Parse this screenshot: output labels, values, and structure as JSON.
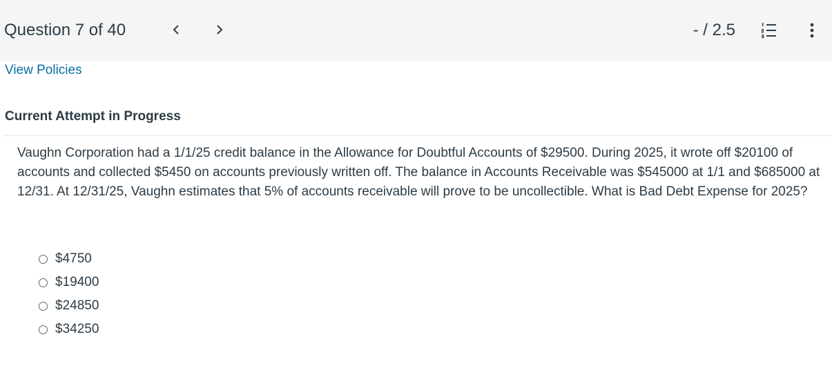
{
  "header": {
    "question_label": "Question 7 of 40",
    "score": "- / 2.5",
    "icons": {
      "prev": "chevron-left-icon",
      "next": "chevron-right-icon",
      "list": "numbered-list-icon",
      "more": "vertical-ellipsis-icon"
    }
  },
  "links": {
    "view_policies": "View Policies"
  },
  "section": {
    "attempt_title": "Current Attempt in Progress"
  },
  "question": {
    "text": "Vaughn Corporation had a 1/1/25 credit balance in the Allowance for Doubtful Accounts of $29500. During 2025, it wrote off $20100 of accounts and collected $5450 on accounts previously written off. The balance in Accounts Receivable was $545000 at 1/1 and $685000 at 12/31. At 12/31/25, Vaughn estimates that 5% of accounts receivable will prove to be uncollectible. What is Bad Debt Expense for 2025?"
  },
  "choices": [
    "$4750",
    "$19400",
    "$24850",
    "$34250"
  ],
  "colors": {
    "link": "#0770a3",
    "text": "#2d3b45",
    "header_bg": "#f5f5f5"
  }
}
